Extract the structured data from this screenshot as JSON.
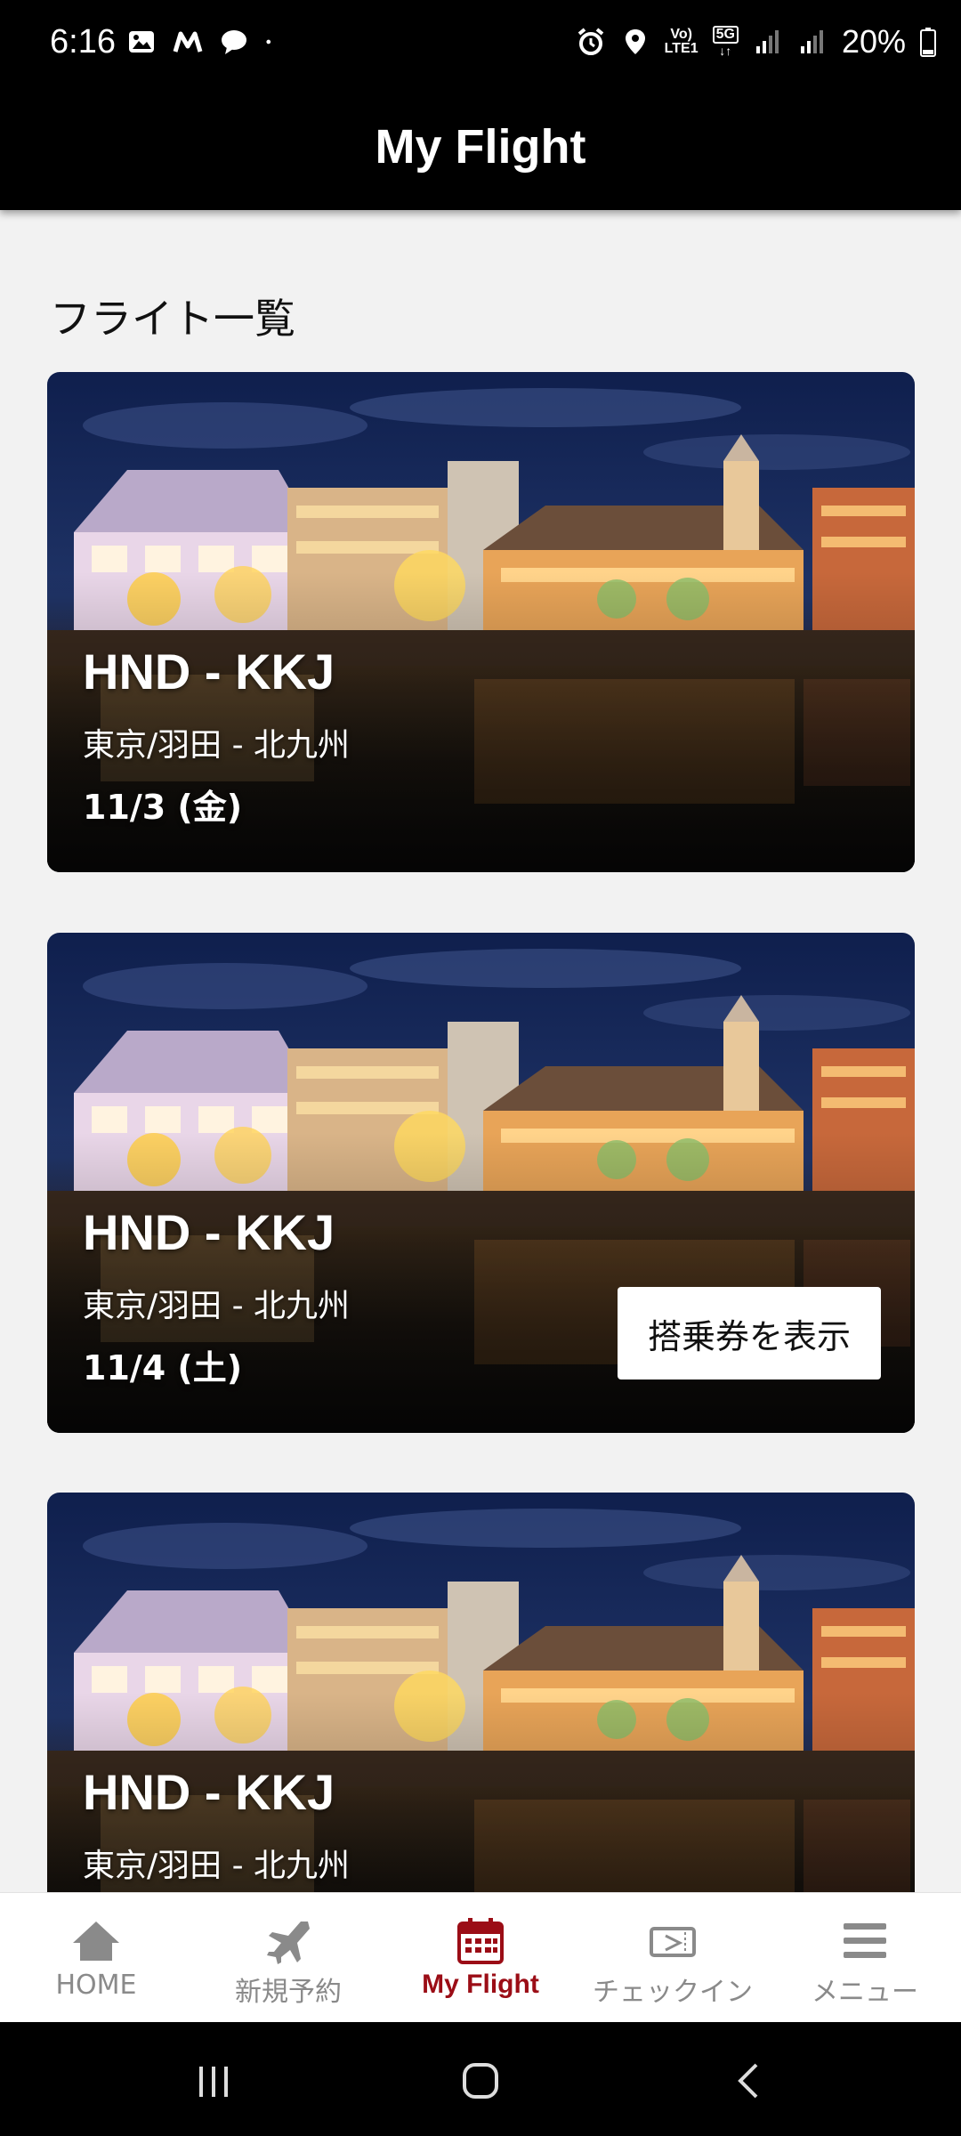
{
  "status_bar": {
    "time": "6:16",
    "battery": "20%",
    "net_tag_top": "Vo)",
    "net_tag_bottom": "LTE1",
    "fiveg_tag": "5G"
  },
  "app_bar": {
    "title": "My Flight"
  },
  "section": {
    "heading": "フライト一覧"
  },
  "flights": [
    {
      "code": "HND - KKJ",
      "route": "東京/羽田 - 北九州",
      "date": "11/3 (金)"
    },
    {
      "code": "HND - KKJ",
      "route": "東京/羽田 - 北九州",
      "date": "11/4 (土)",
      "action": "搭乗券を表示"
    },
    {
      "code": "HND - KKJ",
      "route": "東京/羽田 - 北九州",
      "date": ""
    }
  ],
  "bottom_nav": [
    {
      "label": "HOME",
      "icon": "home-icon"
    },
    {
      "label": "新規予約",
      "icon": "airplane-icon"
    },
    {
      "label": "My Flight",
      "icon": "calendar-icon",
      "active": true
    },
    {
      "label": "チェックイン",
      "icon": "ticket-icon"
    },
    {
      "label": "メニュー",
      "icon": "menu-icon"
    }
  ],
  "colors": {
    "accent": "#9b0d16",
    "app_bar": "#000000",
    "inactive": "#8a8a8a"
  }
}
